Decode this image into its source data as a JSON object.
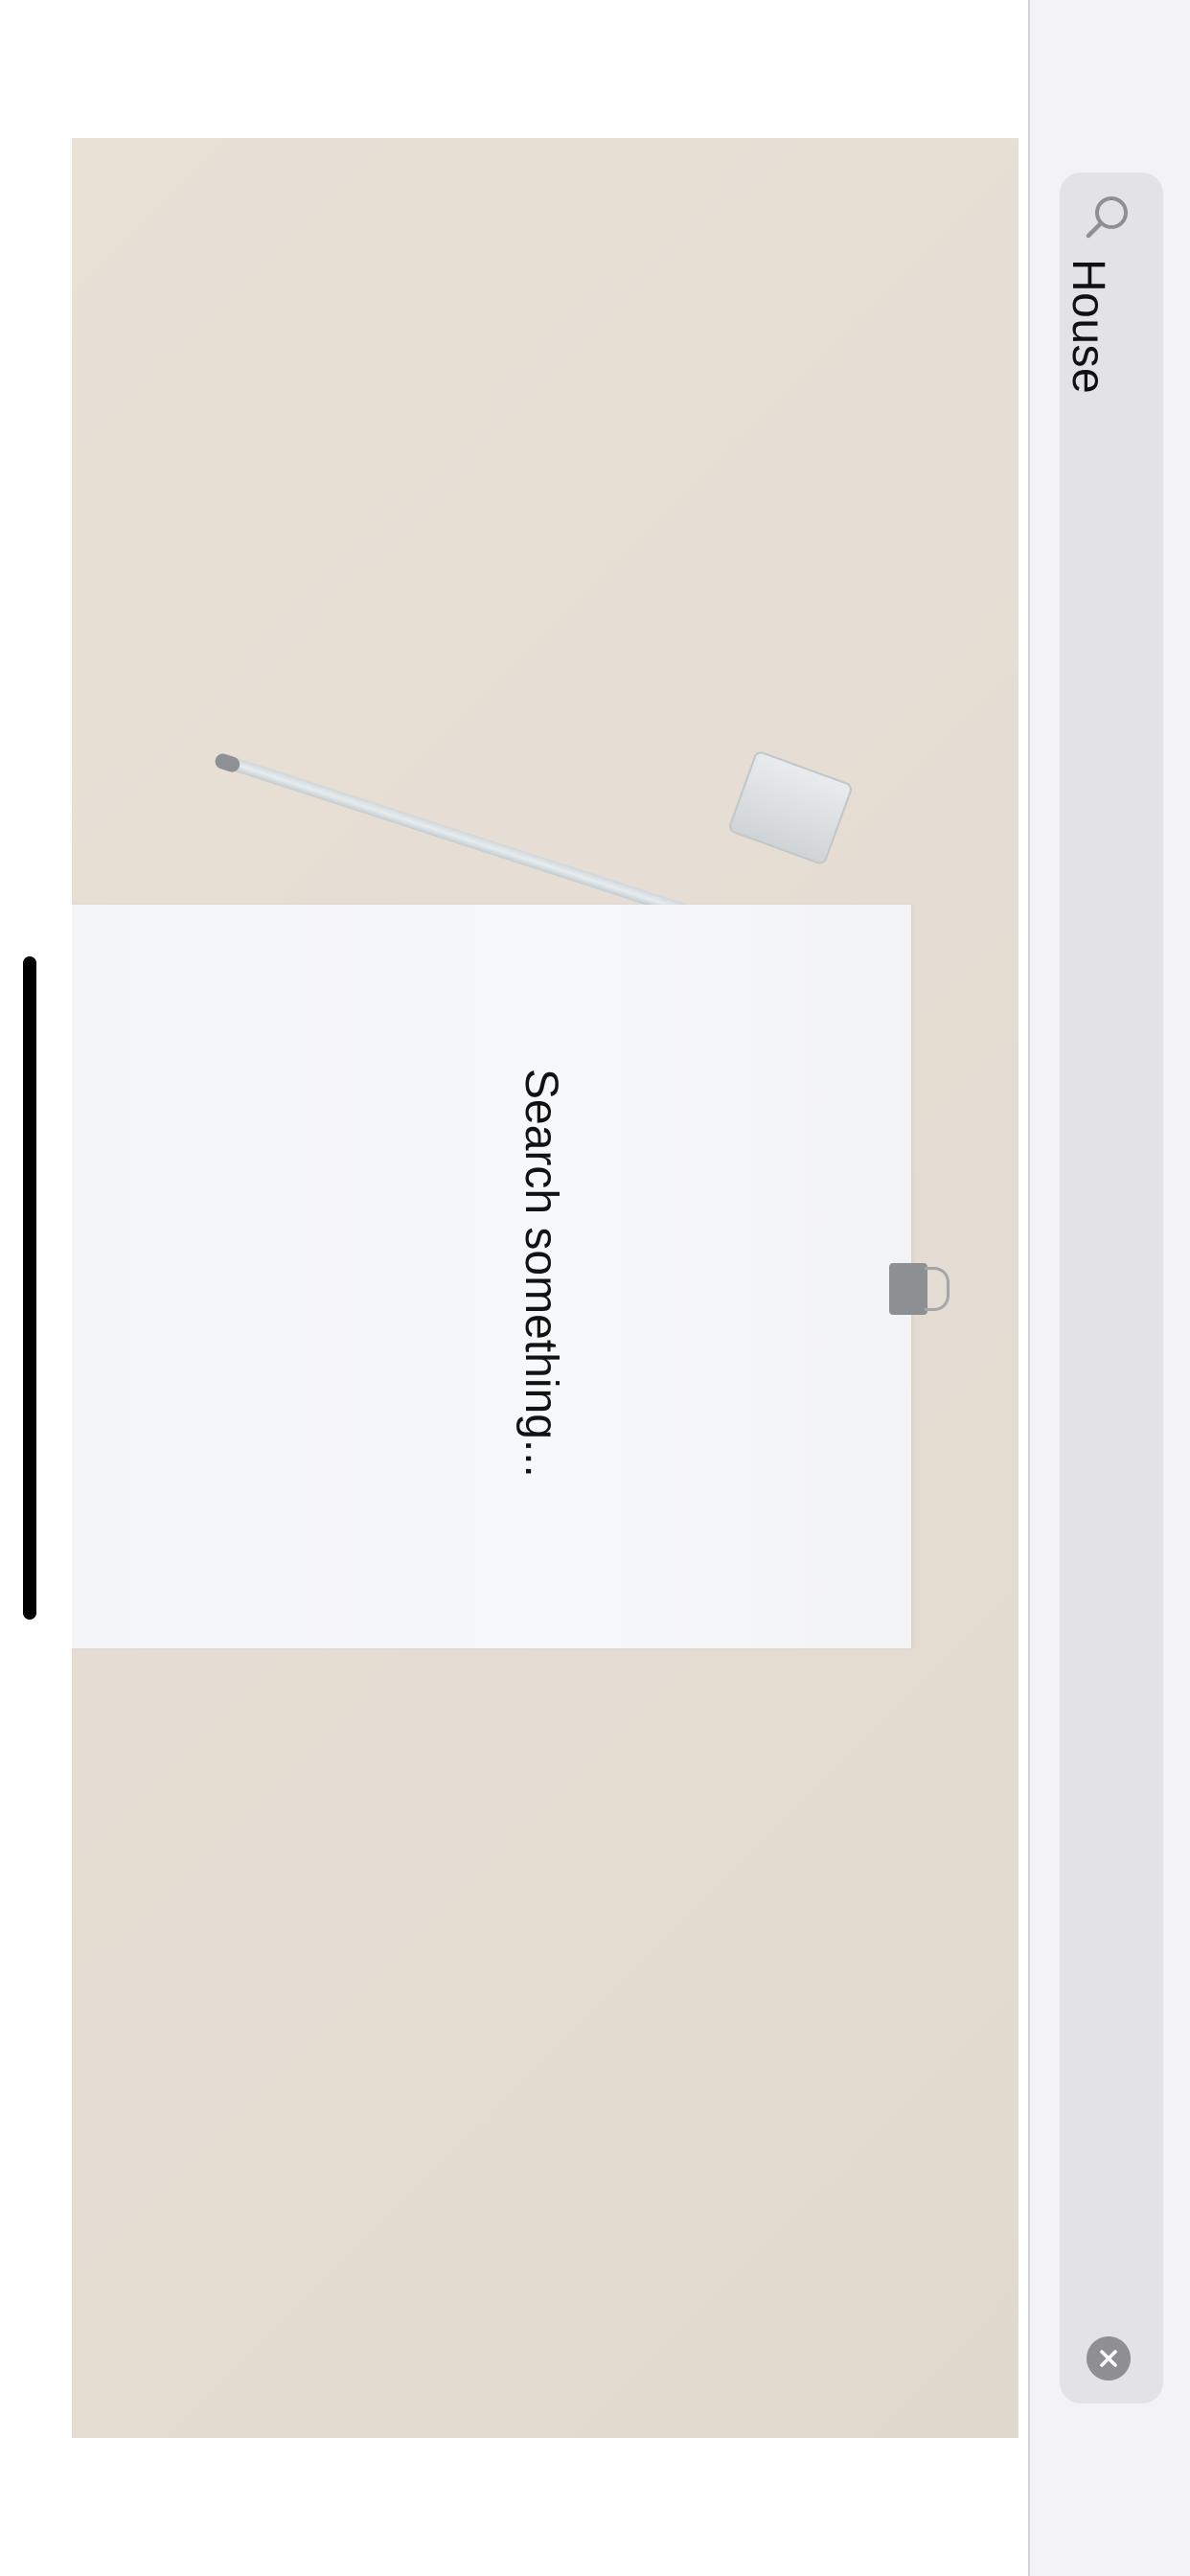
{
  "search": {
    "value": "House"
  },
  "results": {
    "empty_message": "Search something..."
  },
  "icons": {
    "search": "search-icon",
    "clear": "clear-icon"
  },
  "colors": {
    "panel_background": "#f3f3f5",
    "search_field": "#e3e3e6",
    "clear_button": "#8e8e93",
    "photo_background": "#e6ddd3",
    "paper": "#f5f6f8"
  }
}
